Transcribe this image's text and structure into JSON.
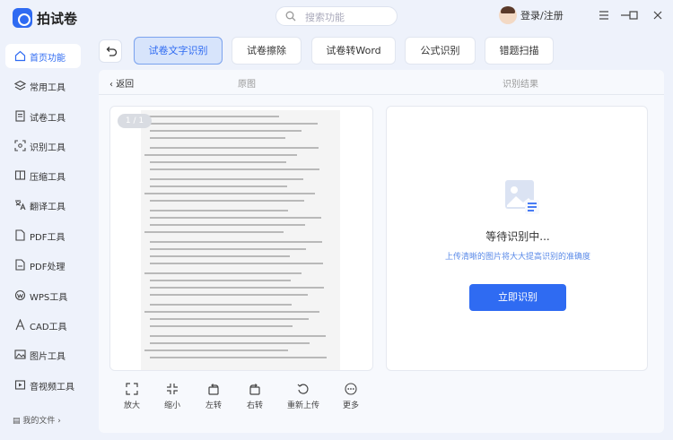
{
  "app": {
    "title": "拍试卷"
  },
  "search": {
    "placeholder": "搜索功能"
  },
  "account": {
    "login_label": "登录/注册"
  },
  "sidebar": {
    "items": [
      {
        "label": "首页功能",
        "icon": "home-icon"
      },
      {
        "label": "常用工具",
        "icon": "layers-icon"
      },
      {
        "label": "试卷工具",
        "icon": "document-icon"
      },
      {
        "label": "识别工具",
        "icon": "scan-icon"
      },
      {
        "label": "压缩工具",
        "icon": "compress-icon"
      },
      {
        "label": "翻译工具",
        "icon": "translate-icon"
      },
      {
        "label": "PDF工具",
        "icon": "pdf-icon"
      },
      {
        "label": "PDF处理",
        "icon": "pdf-process-icon"
      },
      {
        "label": "WPS工具",
        "icon": "wps-icon"
      },
      {
        "label": "CAD工具",
        "icon": "cad-icon"
      },
      {
        "label": "图片工具",
        "icon": "image-icon"
      },
      {
        "label": "音视频工具",
        "icon": "video-icon"
      }
    ],
    "my_files": "我的文件"
  },
  "tabs": [
    {
      "label": "试卷文字识别"
    },
    {
      "label": "试卷擦除"
    },
    {
      "label": "试卷转Word"
    },
    {
      "label": "公式识别"
    },
    {
      "label": "错题扫描"
    }
  ],
  "content": {
    "back_label": "返回",
    "original_label": "原图",
    "result_label": "识别结果",
    "page_counter": "1 / 1",
    "waiting_text": "等待识别中...",
    "hint_text": "上传清晰的图片将大大提高识别的准确度",
    "start_button": "立即识别"
  },
  "toolbar": {
    "zoom_in": "放大",
    "zoom_out": "缩小",
    "rotate_left": "左转",
    "rotate_right": "右转",
    "reupload": "重新上传",
    "more": "更多"
  },
  "colors": {
    "accent": "#2f6bf2",
    "background": "#eef2fb"
  }
}
